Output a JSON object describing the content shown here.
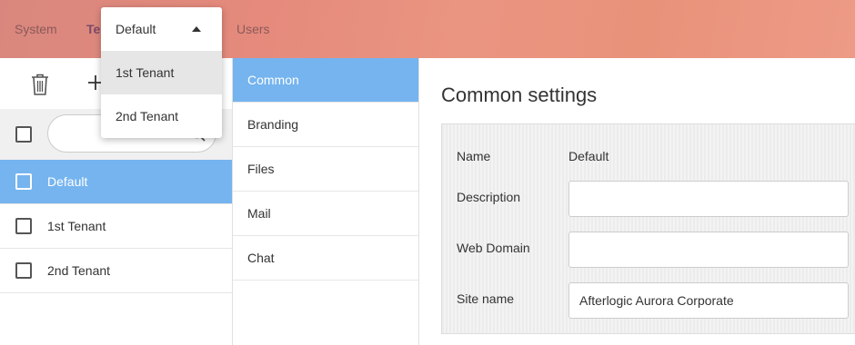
{
  "topbar": {
    "nav": [
      "System",
      "Te",
      "Users"
    ]
  },
  "tenant_selector": {
    "value": "Default",
    "options": [
      "1st Tenant",
      "2nd Tenant"
    ]
  },
  "left": {
    "tenants": [
      "Default",
      "1st Tenant",
      "2nd Tenant"
    ]
  },
  "tabs": [
    "Common",
    "Branding",
    "Files",
    "Mail",
    "Chat"
  ],
  "settings": {
    "title": "Common settings",
    "name_label": "Name",
    "name_value": "Default",
    "description_label": "Description",
    "description_value": "",
    "webdomain_label": "Web Domain",
    "webdomain_value": "",
    "sitename_label": "Site name",
    "sitename_value": "Afterlogic Aurora Corporate"
  },
  "colors": {
    "accent": "#75b4ef",
    "topbar": "#e58a7c"
  },
  "icons": [
    "trash-icon",
    "plus-icon",
    "search-icon",
    "caret-up-icon"
  ]
}
